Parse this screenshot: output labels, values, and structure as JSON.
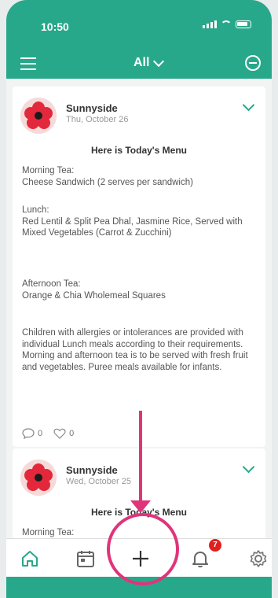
{
  "status_bar": {
    "time": "10:50"
  },
  "nav": {
    "filter_label": "All"
  },
  "posts": [
    {
      "author": "Sunnyside",
      "date": "Thu, October 26",
      "title": "Here is Today's Menu",
      "paragraphs": [
        "Morning Tea:\nCheese Sandwich (2 serves per sandwich)",
        "Lunch:\nRed Lentil & Split Pea Dhal, Jasmine Rice, Served with Mixed Vegetables (Carrot & Zucchini)",
        "Afternoon Tea:\nOrange & Chia Wholemeal Squares",
        "Children with allergies or intolerances are provided with individual Lunch meals according to their requirements. Morning and afternoon tea is to be served with fresh fruit and vegetables. Puree meals available for infants."
      ],
      "comments": "0",
      "likes": "0"
    },
    {
      "author": "Sunnyside",
      "date": "Wed, October 25",
      "title": "Here is Today's Menu",
      "paragraphs": [
        "Morning Tea:"
      ]
    }
  ],
  "tabbar": {
    "notification_count": "7",
    "icons": [
      "home-icon",
      "calendar-icon",
      "plus-icon",
      "bell-icon",
      "gear-icon"
    ]
  },
  "colors": {
    "accent": "#27a88a",
    "highlight": "#e0347a",
    "badge": "#e02020"
  }
}
